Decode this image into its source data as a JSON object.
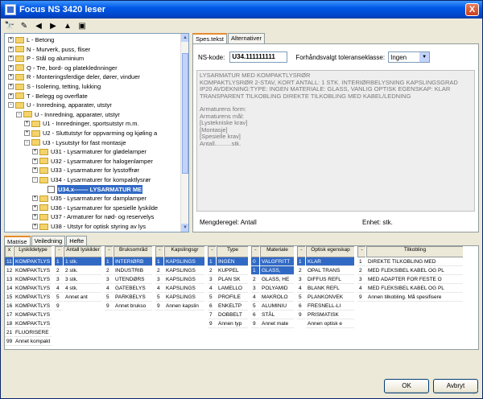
{
  "window": {
    "title": "Focus NS 3420 leser",
    "close_glyph": "X"
  },
  "toolbar": {
    "icons": [
      "binoculars-icon",
      "lock-icon",
      "back-icon",
      "forward-icon",
      "up-icon",
      "book-icon"
    ]
  },
  "tree": {
    "items": [
      {
        "label": "L - Betong",
        "level": 1,
        "exp": "+"
      },
      {
        "label": "N - Murverk, puss, fliser",
        "level": 1,
        "exp": "+"
      },
      {
        "label": "P - Stål og aluminium",
        "level": 1,
        "exp": "+"
      },
      {
        "label": "Q - Tre, bord- og plateklednninger",
        "level": 1,
        "exp": "+"
      },
      {
        "label": "R - Monteringsferdige deler, dører, vinduer",
        "level": 1,
        "exp": "+"
      },
      {
        "label": "S - Isolering, tetting, lukking",
        "level": 1,
        "exp": "+"
      },
      {
        "label": "T - Belegg og overflate",
        "level": 1,
        "exp": "+"
      },
      {
        "label": "U - Innredning, apparater, utstyr",
        "level": 1,
        "exp": "-"
      },
      {
        "label": "U - Innredning, apparater, utstyr",
        "level": 2,
        "exp": "-"
      },
      {
        "label": "U1 - Innredninger, sportsutstyr m.m.",
        "level": 3,
        "exp": "+"
      },
      {
        "label": "U2 - Sluttutstyr for oppvarming og kjøling a",
        "level": 3,
        "exp": "+"
      },
      {
        "label": "U3 - Lysutstyr for fast montasje",
        "level": 3,
        "exp": "-"
      },
      {
        "label": "U31 - Lysarmaturer for glødelamper",
        "level": 4,
        "exp": "+"
      },
      {
        "label": "U32 - Lysarmaturer for halogenlamper",
        "level": 4,
        "exp": "+"
      },
      {
        "label": "U33 - Lysarmaturer for lysstoffrør",
        "level": 4,
        "exp": "+"
      },
      {
        "label": "U34 - Lysarmaturer for kompaktlysrør",
        "level": 4,
        "exp": "-"
      },
      {
        "label": "U34.x------- LYSARMATUR ME",
        "level": 5,
        "exp": "",
        "selected": true
      },
      {
        "label": "U35 - Lysarmaturer for damplamper",
        "level": 4,
        "exp": "+"
      },
      {
        "label": "U36 - Lysarmaturer for spesielle lyskilde",
        "level": 4,
        "exp": "+"
      },
      {
        "label": "U37 - Armaturer for nød- og reservelys",
        "level": 4,
        "exp": "+"
      },
      {
        "label": "U38 - Utstyr for optisk styring av lys",
        "level": 4,
        "exp": "+"
      }
    ]
  },
  "right_tabs": [
    {
      "label": "Spes.tekst",
      "active": true
    },
    {
      "label": "Alternativer",
      "active": false
    }
  ],
  "spec": {
    "ns_label": "NS-kode:",
    "ns_value": "U34.111111111",
    "tol_label": "Forhåndsvalgt toleranseklasse:",
    "tol_value": "Ingen",
    "text_title": "LYSARMATUR MED KOMPAKTLYSRØR",
    "text_body": "Kompaktlysrør 2-stav, kort antall: 1 stk. Interiørbelysning kapslingsgrad IP20 avdekning:type: ingen materiale: glass, vanlig optisk egenskap: klar transparent tilkobling direkte tilkobling med kabel/ledning",
    "lines": [
      "Armaturens form:",
      "Armaturens mål:",
      "[Lystekniske krav]",
      "[Montasje]",
      "[Spesielle krav]",
      "Antall..........stk."
    ],
    "mengde": "Mengderegel: Antall",
    "enhet": "Enhet: stk."
  },
  "bottom_tabs": [
    {
      "label": "Matrise",
      "active": true
    },
    {
      "label": "Veiledning",
      "active": false
    },
    {
      "label": "Hefte",
      "active": false
    }
  ],
  "matrix": {
    "columns": [
      {
        "header": "x",
        "cells": [
          "11",
          "12",
          "13",
          "14",
          "15",
          "16",
          "17",
          "18",
          "21",
          "99"
        ]
      },
      {
        "header": "Lyskildetype",
        "cells": [
          "KOMPAKTLYS",
          "KOMPAKTLYS",
          "KOMPAKTLYS",
          "KOMPAKTLYS",
          "KOMPAKTLYS",
          "KOMPAKTLYS",
          "KOMPAKTLYS",
          "KOMPAKTLYS",
          "FLUORISERE",
          "Annet kompakt"
        ]
      },
      {
        "header": "-",
        "cells": [
          "1",
          "2",
          "3",
          "4",
          "5",
          "9"
        ]
      },
      {
        "header": "Antall lyskilder",
        "cells": [
          "1 stk.",
          "2 stk.",
          "3 stk.",
          "4 stk.",
          "Annet ant"
        ]
      },
      {
        "header": "-",
        "cells": [
          "1",
          "2",
          "3",
          "4",
          "5",
          "9"
        ]
      },
      {
        "header": "Bruksområd",
        "cells": [
          "INTERIØRB",
          "INDUSTRIB",
          "UTENDØRS",
          "GATEBELYS",
          "PARKBELYS",
          "Annet brukso"
        ]
      },
      {
        "header": "-",
        "cells": [
          "1",
          "2",
          "3",
          "4",
          "5",
          "9"
        ]
      },
      {
        "header": "Kapslingsgr",
        "cells": [
          "KAPSLINGS",
          "KAPSLINGS",
          "KAPSLINGS",
          "KAPSLINGS",
          "KAPSLINGS",
          "Annen kapslin"
        ]
      },
      {
        "header": "-",
        "cells": [
          "1",
          "2",
          "3",
          "4",
          "5",
          "6",
          "7",
          "9"
        ]
      },
      {
        "header": "Type",
        "cells": [
          "INGEN",
          "KUPPEL",
          "PLAN SK",
          "LAMELLO",
          "PROFILE",
          "ENKELTP",
          "DOBBELT",
          "Annen typ"
        ]
      },
      {
        "header": "-",
        "cells": [
          "0",
          "1",
          "2",
          "3",
          "4",
          "5",
          "6",
          "9"
        ]
      },
      {
        "header": "Materiale",
        "cells": [
          "VALGFRITT",
          "GLASS,",
          "GLASS, HE",
          "POLYAMID",
          "MAKROLO",
          "ALUMINIU",
          "STÅL",
          "Annet mate"
        ]
      },
      {
        "header": "-",
        "cells": [
          "1",
          "2",
          "3",
          "4",
          "5",
          "6",
          "9"
        ]
      },
      {
        "header": "Optisk egenskap",
        "cells": [
          "KLAR",
          "OPAL TRANS",
          "DIFFUS REFL",
          "BLANK REFL",
          "PLANKONVEK",
          "FRESNELL-LI",
          "PRISMATISK",
          "Annen optisk e"
        ]
      },
      {
        "header": "-",
        "cells": [
          "1",
          "2",
          "3",
          "4",
          "9"
        ]
      },
      {
        "header": "Tilkobling",
        "cells": [
          "DIREKTE TILKOBLING MED",
          "MED FLEKSIBEL KABEL OG PL",
          "MED ADAPTER FOR FESTE O",
          "MED FLEKSIBEL KABEL OG PL",
          "Annen tilkobling. Må spesifisere"
        ]
      }
    ]
  },
  "buttons": {
    "ok": "OK",
    "cancel": "Avbryt"
  }
}
